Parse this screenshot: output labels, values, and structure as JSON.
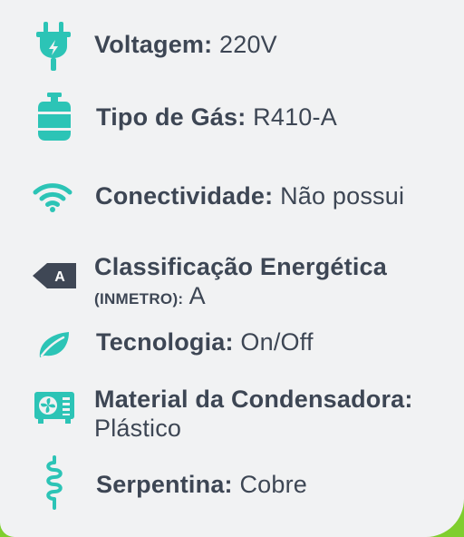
{
  "colors": {
    "icon_accent": "#2cc4b6",
    "text": "#3d4654",
    "background": "#f1f2f3",
    "corner_accent": "#7fce2e"
  },
  "specs": [
    {
      "icon": "power-plug-icon",
      "label": "Voltagem",
      "value": "220V"
    },
    {
      "icon": "gas-cylinder-icon",
      "label": "Tipo de Gás",
      "value": "R410-A"
    },
    {
      "icon": "wifi-icon",
      "label": "Conectividade",
      "value": "Não possui"
    },
    {
      "icon": "energy-class-icon",
      "label": "Classificação Energética",
      "sublabel": "(INMETRO)",
      "value": "A",
      "badge": "A"
    },
    {
      "icon": "leaf-icon",
      "label": "Tecnologia",
      "value": "On/Off"
    },
    {
      "icon": "condenser-unit-icon",
      "label": "Material da Condensadora",
      "value": "Plástico"
    },
    {
      "icon": "coil-icon",
      "label": "Serpentina",
      "value": "Cobre"
    }
  ]
}
